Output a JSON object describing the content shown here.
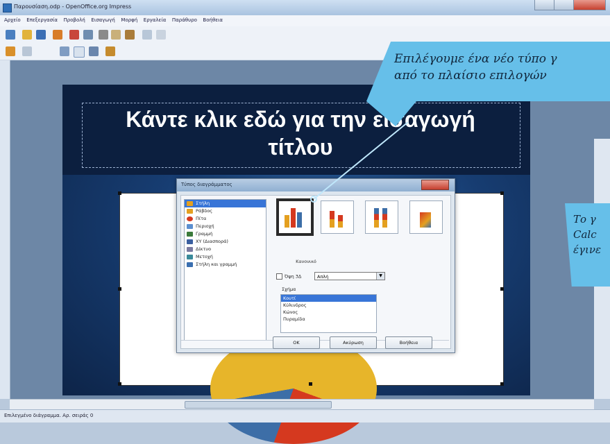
{
  "window": {
    "title": "Παρουσίαση.odp - OpenOffice.org Impress"
  },
  "menu": [
    "Αρχείο",
    "Επεξεργασία",
    "Προβολή",
    "Εισαγωγή",
    "Μορφή",
    "Εργαλεία",
    "Παράθυρο",
    "Βοήθεια"
  ],
  "slide": {
    "title_line1": "Κάντε κλικ εδώ για την εισαγωγή",
    "title_line2": "τίτλου"
  },
  "dialog": {
    "title": "Τύπος διαγράμματος",
    "chart_types": [
      {
        "label": "Στήλη",
        "selected": true,
        "color": "#e4a020"
      },
      {
        "label": "Ράβδος",
        "selected": false,
        "color": "#e4a020"
      },
      {
        "label": "Πίτα",
        "selected": false,
        "color": "#d5391f"
      },
      {
        "label": "Περιοχή",
        "selected": false,
        "color": "#5b8fd0"
      },
      {
        "label": "Γραμμή",
        "selected": false,
        "color": "#3b7a3b"
      },
      {
        "label": "XY (Διασπορά)",
        "selected": false,
        "color": "#3a5fa0"
      },
      {
        "label": "Δίκτυο",
        "selected": false,
        "color": "#7a7aa0"
      },
      {
        "label": "Μετοχή",
        "selected": false,
        "color": "#3a8a9a"
      },
      {
        "label": "Στήλη και γραμμή",
        "selected": false,
        "color": "#3a6fb0"
      }
    ],
    "variant_label": "Κανονικό",
    "three_d_label": "Όψη 3Δ",
    "three_d_value": "Απλή",
    "shape_label": "Σχήμα",
    "shapes": [
      {
        "label": "Κουτί",
        "selected": true
      },
      {
        "label": "Κύλινδρος",
        "selected": false
      },
      {
        "label": "Κώνος",
        "selected": false
      },
      {
        "label": "Πυραμίδα",
        "selected": false
      }
    ],
    "buttons": {
      "ok": "OK",
      "cancel": "Ακύρωση",
      "help": "Βοήθεια"
    }
  },
  "callouts": {
    "top_line1": "Επιλέγουμε ένα νέο τύπο γ",
    "top_line2": "από το πλαίσιο επιλογών",
    "right_line1": "Το γ",
    "right_line2": "Calc",
    "right_line3": "έγινε"
  },
  "statusbar": {
    "text": "Επιλεγμένο διάγραμμα. Αρ. σειράς 0"
  },
  "colors": {
    "callout": "#66bfe9",
    "selection": "#3875d7",
    "slide_text": "#ffffff"
  }
}
